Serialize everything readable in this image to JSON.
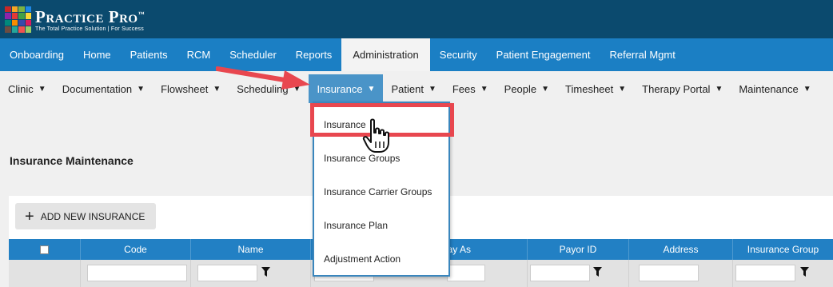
{
  "header": {
    "logo_name": "Practice Pro",
    "logo_tm": "™",
    "logo_tagline": "The Total Practice Solution | For Success",
    "logo_colors": [
      "#c62828",
      "#f5a623",
      "#7cb342",
      "#1e88e5",
      "#8e24aa",
      "#e53935",
      "#43a047",
      "#fdd835",
      "#00897b",
      "#fb8c00",
      "#3949ab",
      "#d81b60",
      "#6d4c41",
      "#26a69a",
      "#ef5350",
      "#9ccc65"
    ]
  },
  "main_nav": {
    "tabs": [
      {
        "label": "Onboarding"
      },
      {
        "label": "Home"
      },
      {
        "label": "Patients"
      },
      {
        "label": "RCM"
      },
      {
        "label": "Scheduler"
      },
      {
        "label": "Reports"
      },
      {
        "label": "Administration",
        "active": true
      },
      {
        "label": "Security"
      },
      {
        "label": "Patient Engagement"
      },
      {
        "label": "Referral Mgmt"
      }
    ]
  },
  "sub_nav": {
    "items": [
      {
        "label": "Clinic"
      },
      {
        "label": "Documentation"
      },
      {
        "label": "Flowsheet"
      },
      {
        "label": "Scheduling"
      },
      {
        "label": "Insurance",
        "active": true
      },
      {
        "label": "Patient"
      },
      {
        "label": "Fees"
      },
      {
        "label": "People"
      },
      {
        "label": "Timesheet"
      },
      {
        "label": "Therapy Portal"
      },
      {
        "label": "Maintenance"
      }
    ],
    "caret": "▼"
  },
  "insurance_menu": {
    "items": [
      {
        "label": "Insurance",
        "highlighted": true
      },
      {
        "label": "Insurance Groups"
      },
      {
        "label": "Insurance Carrier Groups"
      },
      {
        "label": "Insurance Plan"
      },
      {
        "label": "Adjustment Action"
      }
    ]
  },
  "page": {
    "title": "Insurance Maintenance",
    "add_button": "ADD NEW INSURANCE",
    "add_icon": "plus-icon"
  },
  "table": {
    "columns": [
      {
        "label": ""
      },
      {
        "label": "Code"
      },
      {
        "label": "Name"
      },
      {
        "label": "Display As",
        "visible_text": "play As"
      },
      {
        "label": "Payor ID"
      },
      {
        "label": "Address"
      },
      {
        "label": "Insurance Group"
      }
    ]
  },
  "colors": {
    "header_bg": "#0b4a6e",
    "main_nav_bg": "#1b7fc4",
    "active_sub_bg": "#4a94c8",
    "table_header_bg": "#2280c4",
    "highlight": "#e8474f"
  }
}
